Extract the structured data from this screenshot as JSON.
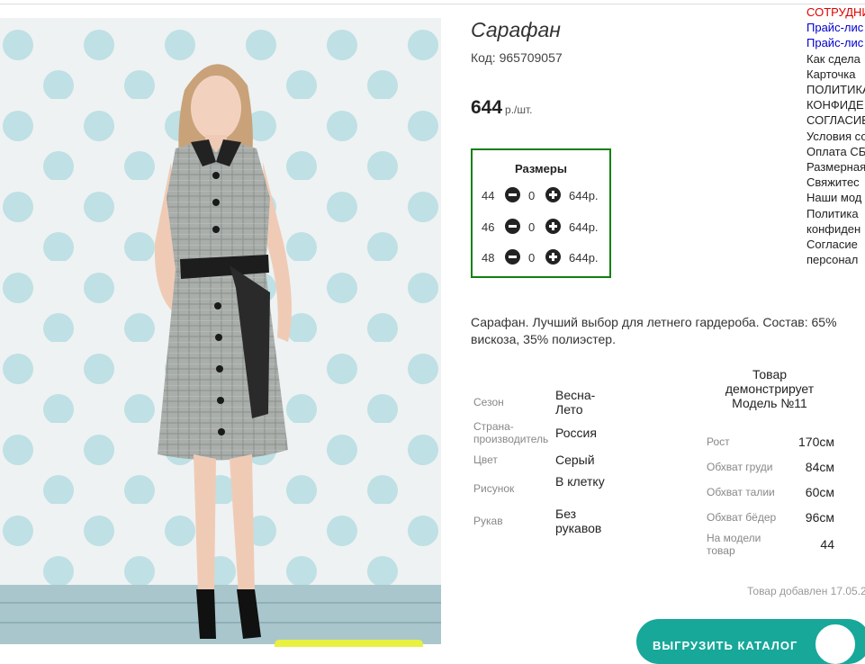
{
  "product": {
    "title": "Сарафан",
    "code": "Код: 965709057",
    "price": "644",
    "price_unit": "р./шт."
  },
  "sizes": {
    "title": "Размеры",
    "rows": [
      {
        "size": "44",
        "qty": "0",
        "price": "644р."
      },
      {
        "size": "46",
        "qty": "0",
        "price": "644р."
      },
      {
        "size": "48",
        "qty": "0",
        "price": "644р."
      }
    ]
  },
  "description": "Сарафан. Лучший выбор для летнего гардероба. Состав: 65% вискоза, 35% полиэстер.",
  "attributes": [
    {
      "label": "Сезон",
      "value": "Весна-Лето"
    },
    {
      "label": "Страна-производитель",
      "value": "Россия"
    },
    {
      "label": "Цвет",
      "value": "Серый"
    },
    {
      "label": "Рисунок",
      "value": "В клетку"
    },
    {
      "label": "Рукав",
      "value": "Без рукавов"
    }
  ],
  "model": {
    "heading": "Товар демонстрирует Модель №11",
    "params": [
      {
        "label": "Рост",
        "value": "170см"
      },
      {
        "label": "Обхват груди",
        "value": "84см"
      },
      {
        "label": "Обхват талии",
        "value": "60см"
      },
      {
        "label": "Обхват бёдер",
        "value": "96см"
      },
      {
        "label": "На модели товар",
        "value": "44"
      }
    ]
  },
  "added": "Товар добавлен 17.05.2",
  "right_links": [
    "СОТРУДНИ",
    "Прайс-лис",
    "Прайс-лис",
    "Как сдела",
    "Карточка",
    "ПОЛИТИКА",
    "КОНФИДЕ",
    "СОГЛАСИЕ",
    "Условия со",
    "Оплата СБ",
    "Размерная",
    "Свяжитес",
    "Наши мод",
    "Политика",
    "конфиден",
    "Согласие",
    "персонал"
  ],
  "catalog_button": "ВЫГРУЗИТЬ КАТАЛОГ",
  "colors": {
    "sizes_border": "#108010",
    "link_red": "#e00000",
    "link_blue": "#0000cc",
    "catalog_teal": "#17a89a"
  }
}
